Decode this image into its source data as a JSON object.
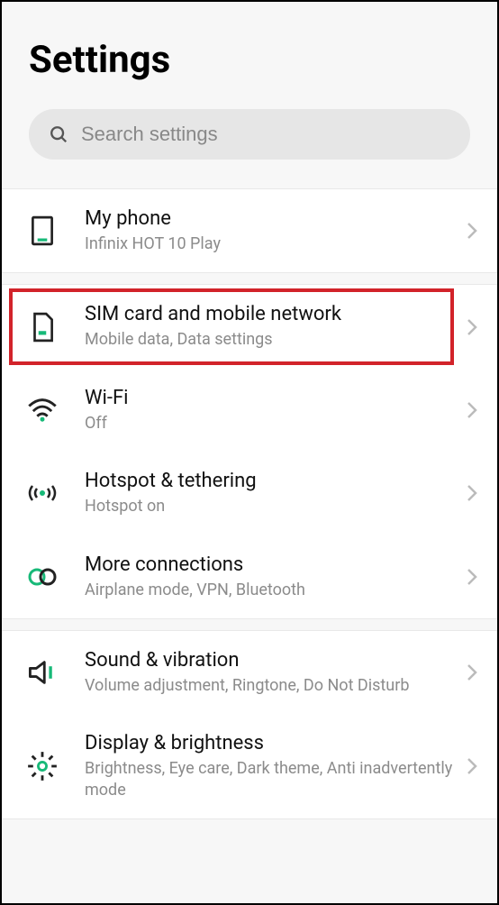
{
  "header": {
    "title": "Settings"
  },
  "search": {
    "placeholder": "Search settings"
  },
  "sections": [
    {
      "items": [
        {
          "id": "my-phone",
          "icon": "phone-icon",
          "title": "My phone",
          "subtitle": "Infinix HOT 10 Play",
          "highlighted": false
        }
      ]
    },
    {
      "items": [
        {
          "id": "sim-card",
          "icon": "sim-icon",
          "title": "SIM card and mobile network",
          "subtitle": "Mobile data, Data settings",
          "highlighted": true
        },
        {
          "id": "wifi",
          "icon": "wifi-icon",
          "title": "Wi-Fi",
          "subtitle": "Off",
          "highlighted": false
        },
        {
          "id": "hotspot",
          "icon": "hotspot-icon",
          "title": "Hotspot & tethering",
          "subtitle": "Hotspot on",
          "highlighted": false
        },
        {
          "id": "more-connections",
          "icon": "link-icon",
          "title": "More connections",
          "subtitle": "Airplane mode, VPN, Bluetooth",
          "highlighted": false
        }
      ]
    },
    {
      "items": [
        {
          "id": "sound",
          "icon": "volume-icon",
          "title": "Sound & vibration",
          "subtitle": "Volume adjustment, Ringtone, Do Not Disturb",
          "highlighted": false
        },
        {
          "id": "display",
          "icon": "brightness-icon",
          "title": "Display & brightness",
          "subtitle": "Brightness, Eye care, Dark theme, Anti inadvertently mode",
          "highlighted": false
        }
      ]
    }
  ]
}
